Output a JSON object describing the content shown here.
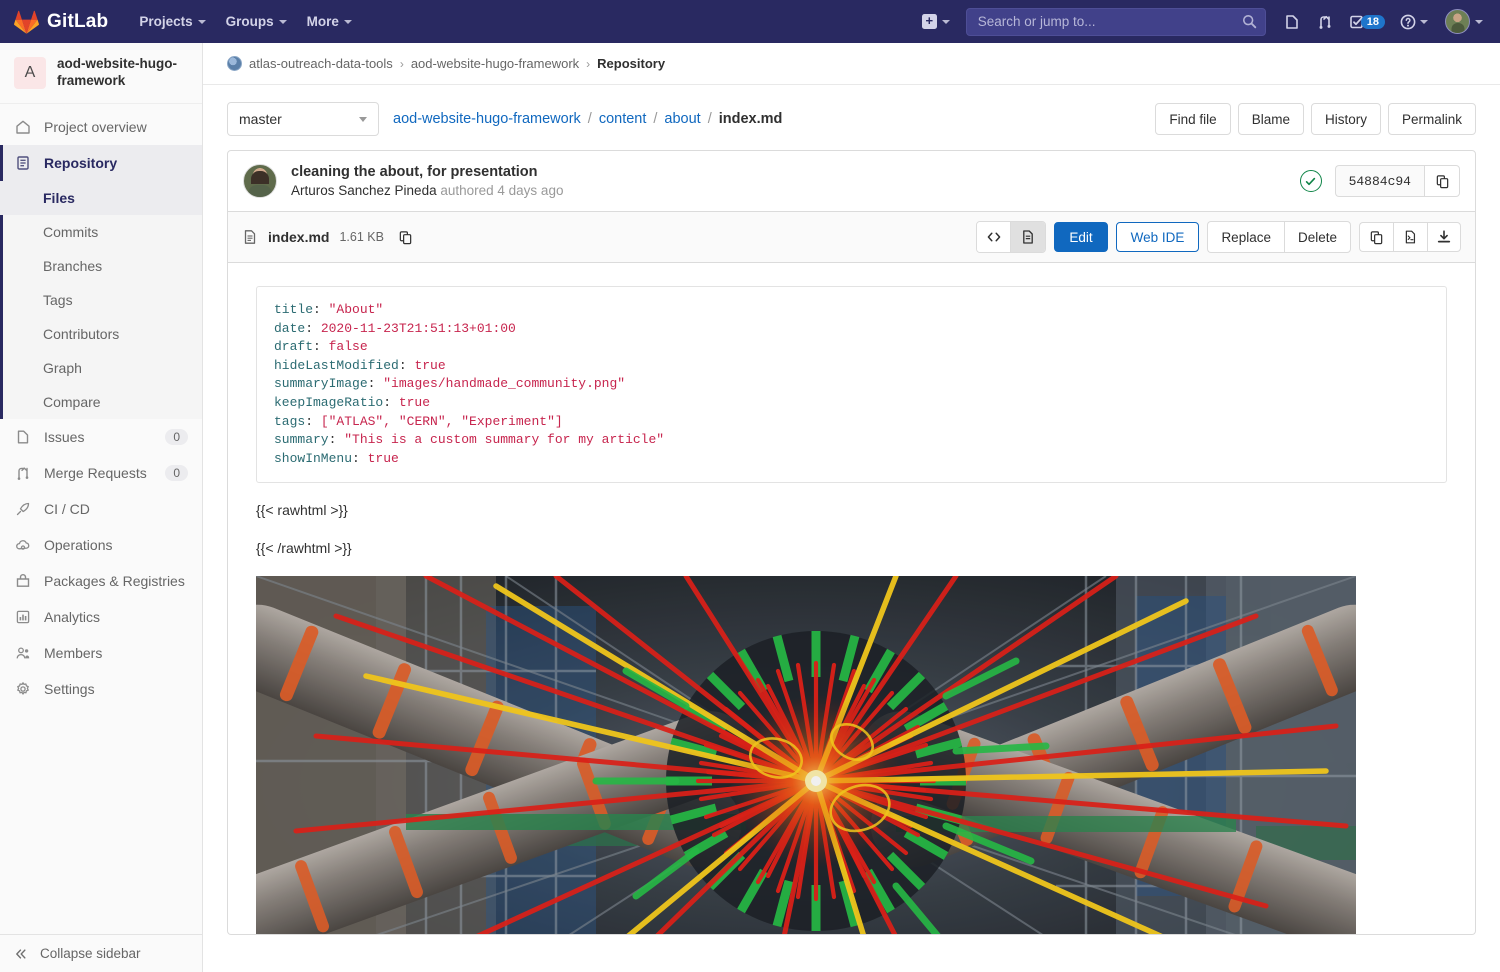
{
  "navbar": {
    "brand": "GitLab",
    "links": [
      {
        "label": "Projects",
        "name": "nav-projects"
      },
      {
        "label": "Groups",
        "name": "nav-groups"
      },
      {
        "label": "More",
        "name": "nav-more"
      }
    ],
    "plus_icon": "plus-square-icon",
    "search_placeholder": "Search or jump to...",
    "search_value": "",
    "search_icon": "search-icon",
    "issues_icon": "issues-icon",
    "merge_requests_icon": "merge-request-icon",
    "todos_icon": "todos-icon",
    "todos_count": "18",
    "help_icon": "question-circle-icon",
    "avatar_icon": "user-avatar"
  },
  "sidebar": {
    "project_initial": "A",
    "project_name": "aod-website-hugo-framework",
    "items": [
      {
        "label": "Project overview",
        "icon": "home-icon",
        "count": ""
      },
      {
        "label": "Repository",
        "icon": "document-icon",
        "count": ""
      },
      {
        "label": "Issues",
        "icon": "issues-icon",
        "count": "0"
      },
      {
        "label": "Merge Requests",
        "icon": "merge-request-icon",
        "count": "0"
      },
      {
        "label": "CI / CD",
        "icon": "rocket-icon",
        "count": ""
      },
      {
        "label": "Operations",
        "icon": "cloud-gear-icon",
        "count": ""
      },
      {
        "label": "Packages & Registries",
        "icon": "package-icon",
        "count": ""
      },
      {
        "label": "Analytics",
        "icon": "chart-icon",
        "count": ""
      },
      {
        "label": "Members",
        "icon": "users-icon",
        "count": ""
      },
      {
        "label": "Settings",
        "icon": "gear-icon",
        "count": ""
      }
    ],
    "repository_subitems": [
      {
        "label": "Files",
        "active": true
      },
      {
        "label": "Commits",
        "active": false
      },
      {
        "label": "Branches",
        "active": false
      },
      {
        "label": "Tags",
        "active": false
      },
      {
        "label": "Contributors",
        "active": false
      },
      {
        "label": "Graph",
        "active": false
      },
      {
        "label": "Compare",
        "active": false
      }
    ],
    "collapse_label": "Collapse sidebar",
    "collapse_icon": "chevron-double-left-icon"
  },
  "breadcrumb": {
    "group_icon": "group-avatar-icon",
    "group": "atlas-outreach-data-tools",
    "project": "aod-website-hugo-framework",
    "current": "Repository",
    "separator": "›"
  },
  "file_bar": {
    "branch": "master",
    "path_root": "aod-website-hugo-framework",
    "path_parts": [
      "content",
      "about"
    ],
    "path_file": "index.md",
    "actions": [
      "Find file",
      "Blame",
      "History",
      "Permalink"
    ]
  },
  "commit": {
    "title": "cleaning the about, for presentation",
    "author": "Arturos Sanchez Pineda",
    "authored_text": "authored 4 days ago",
    "status_icon": "check-circle-icon",
    "sha": "54884c94",
    "copy_icon": "copy-icon"
  },
  "file_header": {
    "file_icon": "file-doc-icon",
    "filename": "index.md",
    "size": "1.61 KB",
    "copy_path_icon": "copy-icon",
    "view_code_icon": "code-icon",
    "view_preview_icon": "preview-doc-icon",
    "edit_label": "Edit",
    "web_ide_label": "Web IDE",
    "replace_label": "Replace",
    "delete_label": "Delete",
    "copy_contents_icon": "copy-icon",
    "open_raw_icon": "raw-file-icon",
    "download_icon": "download-icon",
    "accent_color": "#1068bf"
  },
  "file_content": {
    "frontmatter": [
      {
        "key": "title",
        "value": "\"About\"",
        "value_class": "v"
      },
      {
        "key": "date",
        "value": "2020-11-23T21:51:13+01:00",
        "value_class": "v"
      },
      {
        "key": "draft",
        "value": "false",
        "value_class": "v"
      },
      {
        "key": "hideLastModified",
        "value": "true",
        "value_class": "v"
      },
      {
        "key": "summaryImage",
        "value": "\"images/handmade_community.png\"",
        "value_class": "v"
      },
      {
        "key": "keepImageRatio",
        "value": "true",
        "value_class": "v"
      },
      {
        "key": "tags",
        "value": "[\"ATLAS\", \"CERN\", \"Experiment\"]",
        "value_class": "v"
      },
      {
        "key": "summary",
        "value": "\"This is a custom summary for my article\"",
        "value_class": "v"
      },
      {
        "key": "showInMenu",
        "value": "true",
        "value_class": "v"
      }
    ],
    "shortcode_open": "{{< rawhtml >}}",
    "shortcode_close": "{{< /rawhtml >}}",
    "image_alt": "ATLAS detector collision event display"
  }
}
